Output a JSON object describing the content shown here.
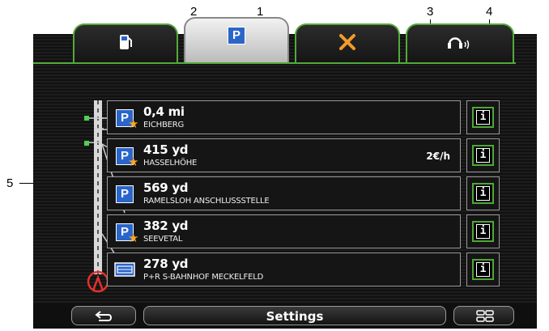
{
  "callouts": {
    "c1": "1",
    "c2": "2",
    "c3": "3",
    "c4": "4",
    "c5": "5"
  },
  "tabs": [
    {
      "icon": "fuel-pump-icon"
    },
    {
      "icon": "parking-icon",
      "glyph": "P",
      "active": true
    },
    {
      "icon": "cross-icon"
    },
    {
      "icon": "headset-icon"
    }
  ],
  "rows": [
    {
      "icon": "parking-favorite-icon",
      "distance": "0,4 mi",
      "name": "EICHBERG",
      "price": ""
    },
    {
      "icon": "parking-garage-favorite-icon",
      "distance": "415 yd",
      "name": "HASSELHÖHE",
      "price": "2€/h"
    },
    {
      "icon": "parking-garage-icon",
      "distance": "569 yd",
      "name": "RAMELSLOH ANSCHLUSSSTELLE",
      "price": ""
    },
    {
      "icon": "parking-garage-favorite-icon",
      "distance": "382 yd",
      "name": "SEEVETAL",
      "price": ""
    },
    {
      "icon": "park-and-ride-icon",
      "distance": "278 yd",
      "name": "P+R S-BAHNHOF MECKELFELD",
      "price": ""
    }
  ],
  "info_glyph": "i",
  "bottom": {
    "settings_label": "Settings"
  },
  "colors": {
    "accent_green": "#54a93b",
    "parking_blue": "#2a65c9",
    "favorite_star": "#f6a623"
  }
}
